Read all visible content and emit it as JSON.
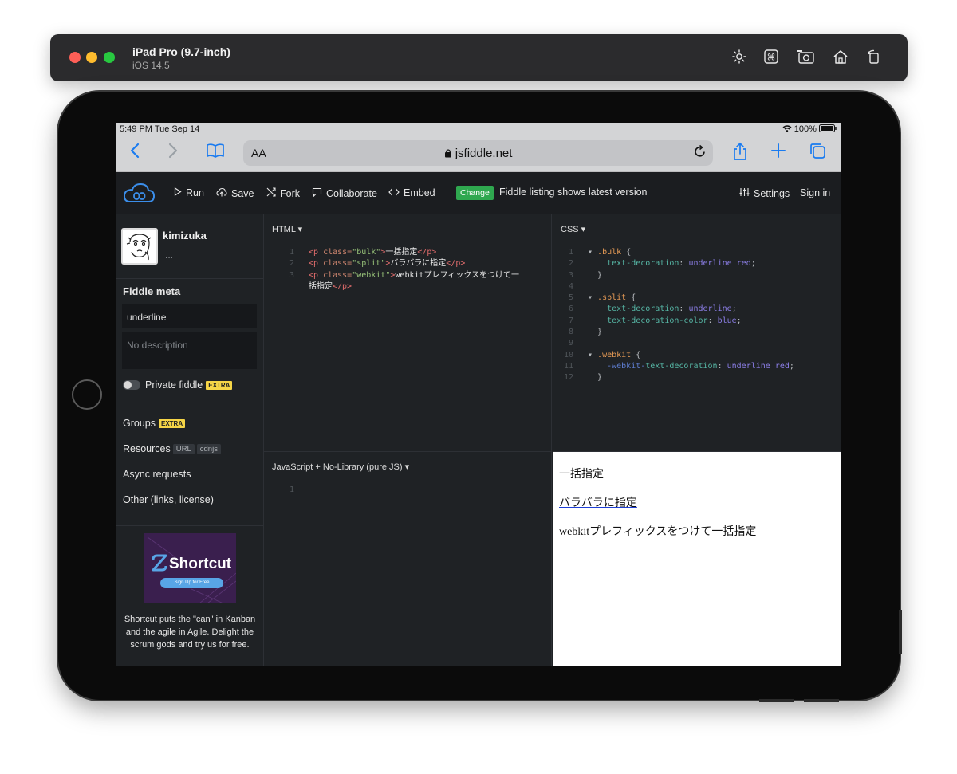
{
  "simulator": {
    "device_name": "iPad Pro (9.7-inch)",
    "os_version": "iOS 14.5",
    "icons": [
      "brightness-icon",
      "command-icon",
      "screenshot-icon",
      "home-icon",
      "rotate-icon"
    ]
  },
  "status_bar": {
    "time": "5:49 PM  Tue Sep 14",
    "battery": "100%"
  },
  "safari": {
    "text_size": "AA",
    "domain": "jsfiddle.net"
  },
  "jsfiddle": {
    "toolbar": {
      "run": "Run",
      "save": "Save",
      "fork": "Fork",
      "collaborate": "Collaborate",
      "embed": "Embed",
      "change_badge": "Change",
      "listing_note": "Fiddle listing shows latest version",
      "settings": "Settings",
      "sign_in": "Sign in"
    },
    "sidebar": {
      "username": "kimizuka",
      "ellipsis": "...",
      "meta_title": "Fiddle meta",
      "title_value": "underline",
      "description_placeholder": "No description",
      "private_label": "Private fiddle",
      "extra_badge": "EXTRA",
      "groups": "Groups",
      "resources": "Resources",
      "resources_url": "URL",
      "resources_cdnjs": "cdnjs",
      "async": "Async requests",
      "other": "Other (links, license)",
      "ad_brand": "Shortcut",
      "ad_cta": "Sign Up for Free",
      "ad_text": "Shortcut puts the \"can\" in Kanban and the agile in Agile. Delight the scrum gods and try us for free."
    },
    "panels": {
      "html_label": "HTML ▾",
      "css_label": "CSS ▾",
      "js_label": "JavaScript + No-Library (pure JS) ▾"
    },
    "html_code": {
      "l1_class": "\"bulk\"",
      "l1_text": "一括指定",
      "l2_class": "\"split\"",
      "l2_text": "バラバラに指定",
      "l3_class": "\"webkit\"",
      "l3_text_a": "webkitプレフィックスをつけて一",
      "l3_text_b": "括指定"
    },
    "css_code": {
      "bulk_sel": ".bulk",
      "split_sel": ".split",
      "webkit_sel": ".webkit",
      "td": "text-decoration",
      "tdc": "text-decoration-color",
      "wk_prefix": "-webkit-",
      "wk_prop": "text-decoration",
      "v_underline_red": "underline red",
      "v_underline": "underline",
      "v_blue": "blue"
    },
    "result": {
      "line1": "一括指定",
      "line2": "バラバラに指定",
      "line3": "webkitプレフィックスをつけて一括指定"
    },
    "colors": {
      "underline_red": "#e53935",
      "underline_blue": "#1e3fd6",
      "change_green": "#2fa84f",
      "extra_yellow": "#f5d547",
      "safari_blue": "#1a7bf0"
    }
  }
}
